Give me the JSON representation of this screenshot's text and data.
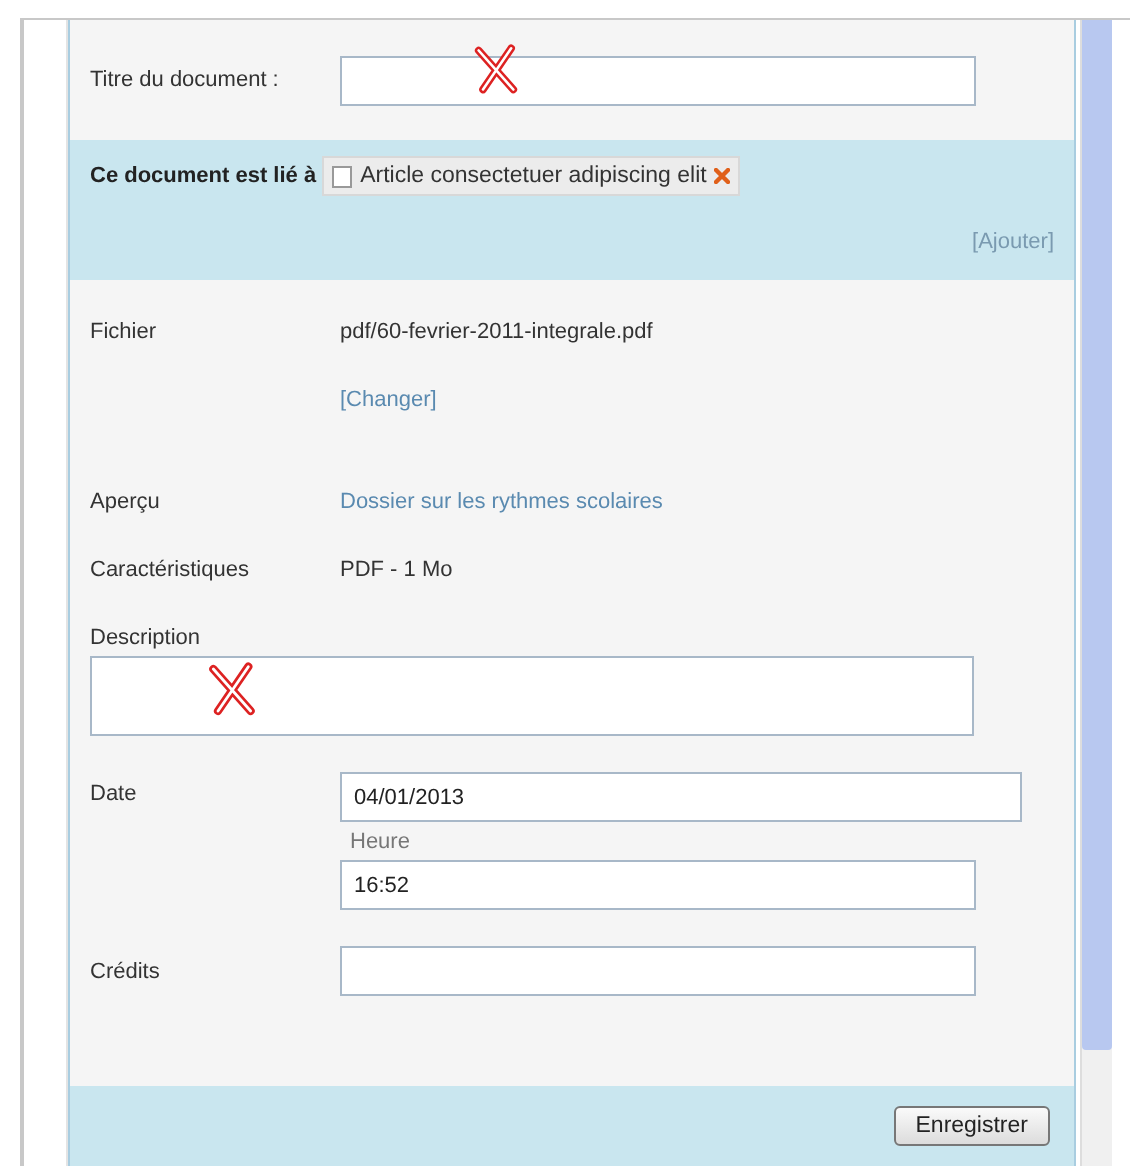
{
  "title_field": {
    "label": "Titre du document :"
  },
  "links": {
    "label": "Ce document est lié à",
    "items": [
      {
        "text": "Article consectetuer adipiscing elit"
      }
    ],
    "add_link": "[Ajouter]"
  },
  "file": {
    "label": "Fichier",
    "value": "pdf/60-fevrier-2011-integrale.pdf",
    "change_link": "[Changer]"
  },
  "preview": {
    "label": "Aperçu",
    "value": "Dossier sur les rythmes scolaires"
  },
  "characteristics": {
    "label": "Caractéristiques",
    "value": "PDF - 1 Mo"
  },
  "description": {
    "label": "Description"
  },
  "date": {
    "label": "Date",
    "value": "04/01/2013"
  },
  "time": {
    "label": "Heure",
    "value": "16:52"
  },
  "credits": {
    "label": "Crédits"
  },
  "save_button": "Enregistrer"
}
